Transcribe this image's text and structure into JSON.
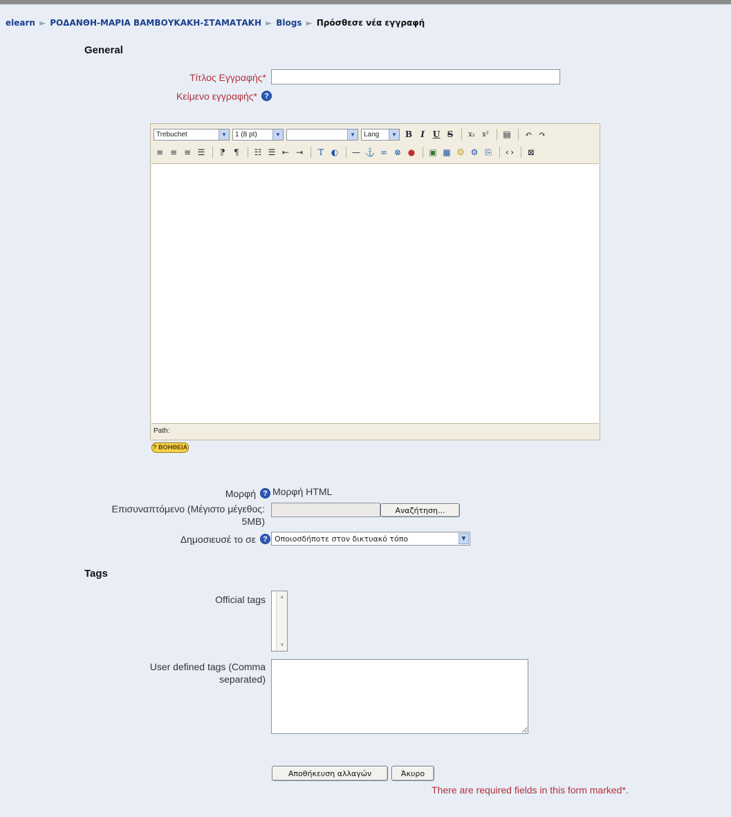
{
  "breadcrumb": {
    "items": [
      "elearn",
      "ΡΟΔΑΝΘΗ-ΜΑΡΙΑ ΒΑΜΒΟΥΚΑΚΗ-ΣΤΑΜΑΤΑΚΗ",
      "Blogs"
    ],
    "separator": "►",
    "current": "Πρόσθεσε νέα εγγραφή"
  },
  "general": {
    "heading": "General",
    "title_label": "Τίτλος Εγγραφής*",
    "title_value": "",
    "body_label": "Κείμενο εγγραφής*",
    "editor": {
      "font_select": "Trebuchet",
      "size_select": "1 (8 pt)",
      "heading_select": "",
      "lang_select": "Lang",
      "path_label": "Path:",
      "help_button": "? ΒΟΗΘΕΙΑ"
    },
    "format_label": "Μορφή",
    "format_value": "Μορφή HTML",
    "attachment_label": "Επισυναπτόμενο (Μέγιστο μέγεθος: 5MB)",
    "browse_button": "Αναζήτηση...",
    "publish_label": "Δημοσιευσέ το σε",
    "publish_value": "Οποιοσδήποτε στον δικτυακό τόπο"
  },
  "tags": {
    "heading": "Tags",
    "official_label": "Official tags",
    "user_label": "User defined tags (Comma separated)",
    "user_value": ""
  },
  "actions": {
    "save_button": "Αποθήκευση αλλαγών",
    "cancel_button": "Άκυρο",
    "required_note": "There are required fields in this form marked*."
  },
  "colors": {
    "background": "#e9eef6",
    "required": "#b0303a",
    "link": "#1b3f8c"
  }
}
